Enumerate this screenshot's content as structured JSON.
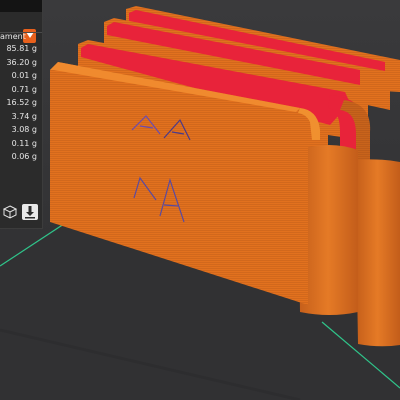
{
  "panel": {
    "filament_label": "ament",
    "weights": [
      "85.81 g",
      "36.20 g",
      "0.01 g",
      "0.71 g",
      "16.52 g",
      "3.74 g",
      "3.08 g",
      "0.11 g",
      "0.06 g"
    ]
  },
  "model": {
    "embossed_text": "A A",
    "colors": {
      "print_orange": "#e2711e",
      "inner_red": "#e8233a",
      "bed_green": "#2fc48a",
      "bed_dark": "#313133",
      "dropdown_accent": "#e8601c"
    }
  },
  "icons": [
    "chevron-down-icon",
    "cube-icon",
    "export-icon"
  ]
}
